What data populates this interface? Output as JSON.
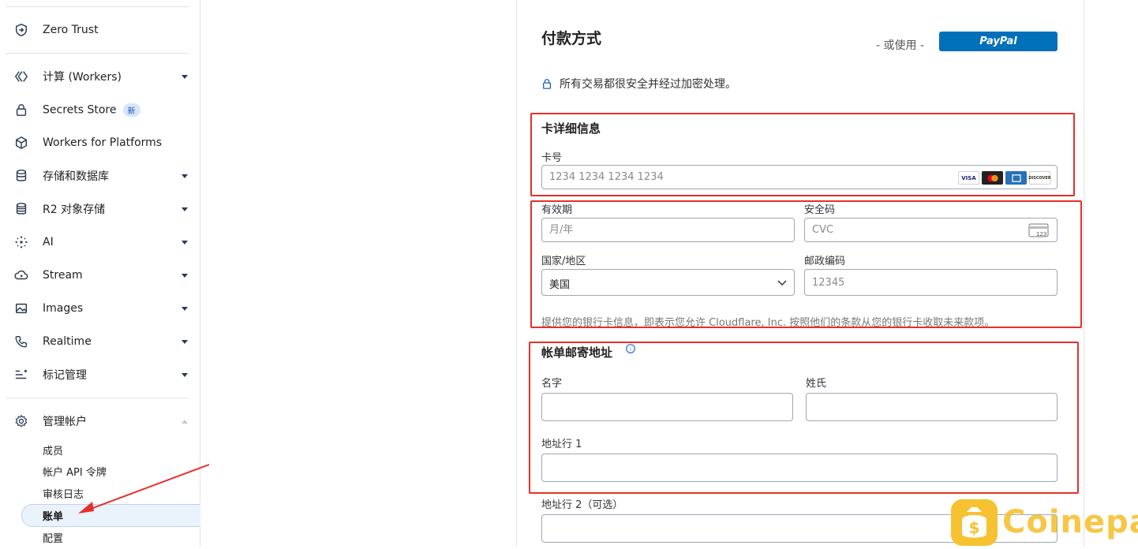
{
  "sidebar": {
    "top_item": {
      "label": "Zero Trust",
      "icon": "shield-arrow-icon"
    },
    "items": [
      {
        "label": "计算 (Workers)",
        "icon": "workers-icon",
        "expandable": true
      },
      {
        "label": "Secrets Store",
        "icon": "lock-icon",
        "badge": "新"
      },
      {
        "label": "Workers for Platforms",
        "icon": "cube-icon"
      },
      {
        "label": "存储和数据库",
        "icon": "database-icon",
        "expandable": true
      },
      {
        "label": "R2 对象存储",
        "icon": "r2-storage-icon",
        "expandable": true
      },
      {
        "label": "AI",
        "icon": "sparkle-icon",
        "expandable": true
      },
      {
        "label": "Stream",
        "icon": "cloud-play-icon",
        "expandable": true
      },
      {
        "label": "Images",
        "icon": "image-icon",
        "expandable": true
      },
      {
        "label": "Realtime",
        "icon": "phone-icon",
        "expandable": true
      },
      {
        "label": "标记管理",
        "icon": "tag-list-icon",
        "expandable": true
      }
    ],
    "manage": {
      "label": "管理帐户",
      "icon": "gear-icon",
      "subitems": [
        "成员",
        "帐户 API 令牌",
        "审核日志",
        "账单",
        "配置"
      ],
      "active": "账单"
    }
  },
  "payment": {
    "title": "付款方式",
    "or_use": "- 或使用 -",
    "paypal": "PayPal",
    "secure_text": "所有交易都很安全并经过加密处理。"
  },
  "card": {
    "heading": "卡详细信息",
    "number_label": "卡号",
    "number_placeholder": "1234 1234 1234 1234",
    "logos": [
      "VISA",
      "Mastercard",
      "AMEX",
      "DISCOVER"
    ],
    "expiry_label": "有效期",
    "expiry_placeholder": "月/年",
    "cvc_label": "安全码",
    "cvc_placeholder": "CVC",
    "cvc_icon_text": "123",
    "country_label": "国家/地区",
    "country_value": "美国",
    "zip_label": "邮政编码",
    "zip_placeholder": "12345",
    "notice": "提供您的银行卡信息，即表示您允许 Cloudflare, Inc. 按照他们的条款从您的银行卡收取未来款项。"
  },
  "billing": {
    "heading": "帐单邮寄地址",
    "info_icon": "ⓘ",
    "first_name_label": "名字",
    "last_name_label": "姓氏",
    "address1_label": "地址行 1",
    "address2_label": "地址行 2（可选）"
  },
  "watermark": {
    "text": "Coinepay"
  },
  "colors": {
    "paypal": "#0070ba",
    "highlight": "#e5302a",
    "watermark": "#f6c232"
  }
}
